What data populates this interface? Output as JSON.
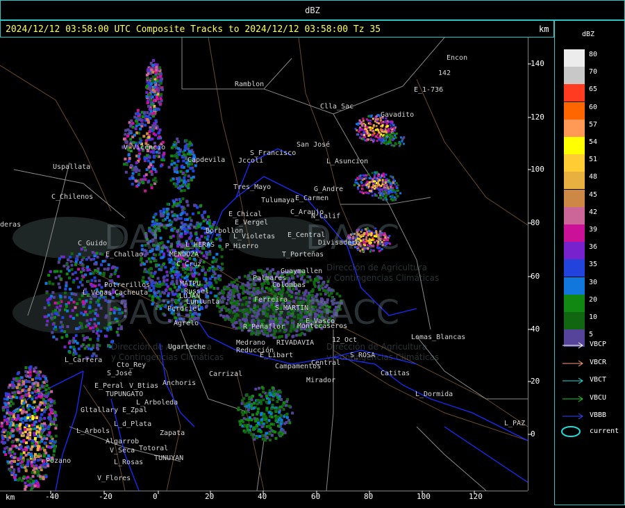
{
  "title": "dBZ",
  "header": "2024/12/12 03:58:00 UTC Composite Tracks to 2024/12/12 03:58:00 Tz 35",
  "km_label": "km",
  "legend": {
    "unit": "dBZ",
    "levels": [
      {
        "label": "80",
        "color": "#ececec"
      },
      {
        "label": "70",
        "color": "#c8c8c8"
      },
      {
        "label": "65",
        "color": "#ff3b22"
      },
      {
        "label": "60",
        "color": "#ff6600"
      },
      {
        "label": "57",
        "color": "#ff9955"
      },
      {
        "label": "54",
        "color": "#ffff00"
      },
      {
        "label": "51",
        "color": "#ffcc33"
      },
      {
        "label": "48",
        "color": "#e8b040"
      },
      {
        "label": "45",
        "color": "#cc8844"
      },
      {
        "label": "42",
        "color": "#cc6699"
      },
      {
        "label": "39",
        "color": "#cc1199"
      },
      {
        "label": "36",
        "color": "#7722cc"
      },
      {
        "label": "35",
        "color": "#2244dd"
      },
      {
        "label": "30",
        "color": "#1177dd"
      },
      {
        "label": "20",
        "color": "#118811"
      },
      {
        "label": "10",
        "color": "#116611"
      },
      {
        "label": "5",
        "color": "#554499"
      }
    ],
    "tracks": [
      {
        "label": "VBCP",
        "color": "#ffffff"
      },
      {
        "label": "VBCR",
        "color": "#ff9977"
      },
      {
        "label": "VBCT",
        "color": "#22dddd"
      },
      {
        "label": "VBCU",
        "color": "#22cc22"
      },
      {
        "label": "VBBB",
        "color": "#3344ff"
      }
    ],
    "current_label": "current"
  },
  "axis": {
    "x_ticks": [
      "-40",
      "-20",
      "0",
      "20",
      "40",
      "60",
      "80",
      "100",
      "120"
    ],
    "y_ticks": [
      "140",
      "120",
      "100",
      "80",
      "60",
      "40",
      "20",
      "0"
    ],
    "x_unit": "km"
  },
  "places": [
    {
      "name": "Ramblon"
    },
    {
      "name": "Encon"
    },
    {
      "name": "E_1-736"
    },
    {
      "name": "142"
    },
    {
      "name": "Clla_Sac"
    },
    {
      "name": "Gavadito"
    },
    {
      "name": "San José"
    },
    {
      "name": "S_Francisco"
    },
    {
      "name": "Jccoli"
    },
    {
      "name": "L_Asuncion"
    },
    {
      "name": "Uspallata"
    },
    {
      "name": "Capdevila"
    },
    {
      "name": "V_Vicencio"
    },
    {
      "name": "Tres_Mayo"
    },
    {
      "name": "G_Andre"
    },
    {
      "name": "Tulumaya"
    },
    {
      "name": "E_Carmen"
    },
    {
      "name": "C_Chilenos"
    },
    {
      "name": "C_Araujo"
    },
    {
      "name": "E_Chical"
    },
    {
      "name": "N_Calif"
    },
    {
      "name": "E_Vergel"
    },
    {
      "name": "Borbollon"
    },
    {
      "name": "E_Central"
    },
    {
      "name": "L_Violetas"
    },
    {
      "name": "Divisadero"
    },
    {
      "name": "C_Guido"
    },
    {
      "name": "L_HERAS"
    },
    {
      "name": "P_Hierro"
    },
    {
      "name": "E_Challao"
    },
    {
      "name": "MENDOZA"
    },
    {
      "name": "T_Porteñas"
    },
    {
      "name": "C_Cruz"
    },
    {
      "name": "Guaymallen"
    },
    {
      "name": "Potrerillos"
    },
    {
      "name": "MAIPU"
    },
    {
      "name": "Russel"
    },
    {
      "name": "Palmares"
    },
    {
      "name": "Colombas"
    },
    {
      "name": "L_Vegas"
    },
    {
      "name": "Cacheuta"
    },
    {
      "name": "LUJAN"
    },
    {
      "name": "Lunlunta"
    },
    {
      "name": "Ferreira"
    },
    {
      "name": "Perdriel"
    },
    {
      "name": "S_MARTIN"
    },
    {
      "name": "Agrelo"
    },
    {
      "name": "R_Peñaflor"
    },
    {
      "name": "Montecaseros"
    },
    {
      "name": "E_Vasco"
    },
    {
      "name": "Ugarteche"
    },
    {
      "name": "Medrano"
    },
    {
      "name": "RIVADAVIA"
    },
    {
      "name": "12_Oct"
    },
    {
      "name": "Lomas_Blancas"
    },
    {
      "name": "L_Carrera"
    },
    {
      "name": "Reducción"
    },
    {
      "name": "E_Libart"
    },
    {
      "name": "S_ROSA"
    },
    {
      "name": "Cto_Rey"
    },
    {
      "name": "Central"
    },
    {
      "name": "S_José"
    },
    {
      "name": "Carrizal"
    },
    {
      "name": "Campamentos"
    },
    {
      "name": "E_Peral"
    },
    {
      "name": "V_Btias"
    },
    {
      "name": "Anchoris"
    },
    {
      "name": "Mirador"
    },
    {
      "name": "Catitas"
    },
    {
      "name": "TUPUNGATO"
    },
    {
      "name": "L_Arboleda"
    },
    {
      "name": "L_Dormida"
    },
    {
      "name": "Gltallary"
    },
    {
      "name": "E_Zpal"
    },
    {
      "name": "L_d_Plata"
    },
    {
      "name": "L_Arbols"
    },
    {
      "name": "Algarrob"
    },
    {
      "name": "Zapata"
    },
    {
      "name": "L_PAZ"
    },
    {
      "name": "V_Seca"
    },
    {
      "name": "Totoral"
    },
    {
      "name": "Pozano"
    },
    {
      "name": "L_Rosas"
    },
    {
      "name": "TUNUYAN"
    },
    {
      "name": "V_Flores"
    },
    {
      "name": "deras"
    }
  ],
  "watermark": {
    "brand": "DACC",
    "line1": "Dirección de Agricultura",
    "line2": "y Contingencias Climáticas"
  }
}
